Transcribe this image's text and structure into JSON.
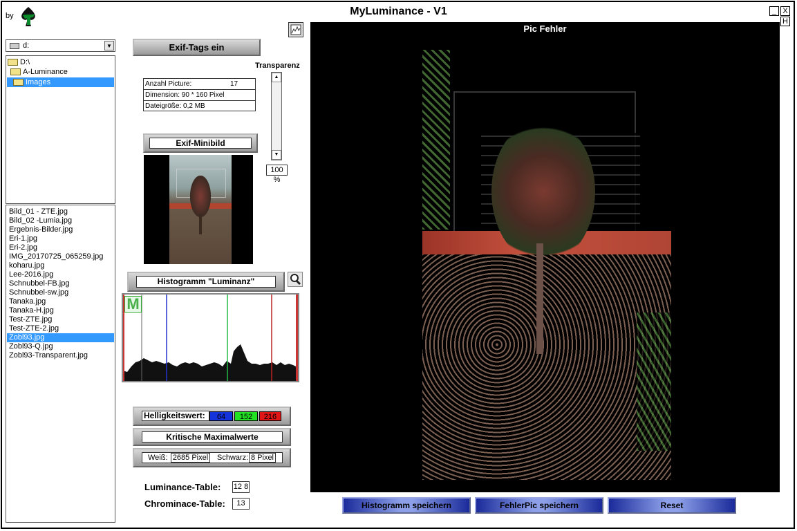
{
  "window": {
    "title": "MyLuminance - V1",
    "by_label": "by",
    "minimize": "_",
    "close": "X",
    "help": "H"
  },
  "drive": {
    "value": "d:"
  },
  "dir_tree": [
    "D:\\",
    "A-Luminance",
    "Images"
  ],
  "files": [
    "Bild_01 - ZTE.jpg",
    "Bild_02 -Lumia.jpg",
    "Ergebnis-Bilder.jpg",
    "Eri-1.jpg",
    "Eri-2.jpg",
    "IMG_20170725_065259.jpg",
    "koharu.jpg",
    "Lee-2016.jpg",
    "Schnubbel-FB.jpg",
    "Schnubbel-sw.jpg",
    "Tanaka.jpg",
    "Tanaka-H.jpg",
    "Test-ZTE.jpg",
    "Test-ZTE-2.jpg",
    "Zobl93.jpg",
    "Zobl93-Q.jpg",
    "Zobl93-Transparent.jpg"
  ],
  "selected_file": "Zobl93.jpg",
  "exif_button": "Exif-Tags ein",
  "info": {
    "count_label": "Anzahl Picture:",
    "count_value": "17",
    "dimension": "Dimension: 90 * 160 Pixel",
    "filesize": "Dateigröße: 0,2 MB"
  },
  "transparency": {
    "label": "Transparenz",
    "value": "100 %"
  },
  "exif_minibild": "Exif-Minibild",
  "histogram": {
    "title": "Histogramm \"Luminanz\"",
    "marker": "M"
  },
  "brightness": {
    "label": "Helligkeitswert:",
    "blue": "64",
    "green": "152",
    "red": "216"
  },
  "critical": "Kritische Maximalwerte",
  "white": {
    "label": "Weiß:",
    "value": "2685  Pixel"
  },
  "black": {
    "label": "Schwarz:",
    "value": "8  Pixel"
  },
  "luminance_table": {
    "label": "Luminance-Table:",
    "value": "12 8"
  },
  "chrominance_table": {
    "label": "Chrominace-Table:",
    "value": "13"
  },
  "pic_title": "Pic Fehler",
  "buttons": {
    "save_hist": "Histogramm speichern",
    "save_pic": "FehlerPic speichern",
    "reset": "Reset"
  }
}
